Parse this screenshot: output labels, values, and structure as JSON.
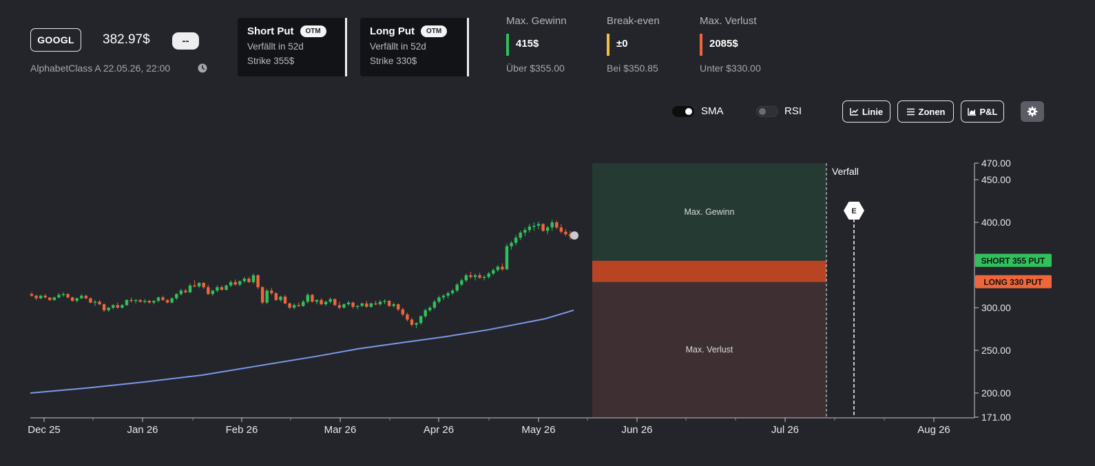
{
  "header": {
    "ticker": "GOOGL",
    "price": "382.97$",
    "change": "--",
    "subline": "AlphabetClass A 22.05.26, 22:00"
  },
  "legs": [
    {
      "title": "Short Put",
      "badge": "OTM",
      "expiry": "Verfällt in 52d",
      "strike": "Strike 355$"
    },
    {
      "title": "Long Put",
      "badge": "OTM",
      "expiry": "Verfällt in 52d",
      "strike": "Strike 330$"
    }
  ],
  "stats": [
    {
      "label": "Max. Gewinn",
      "value": "415$",
      "sub": "Über $355.00",
      "color": "#2fc25b"
    },
    {
      "label": "Break-even",
      "value": "±0",
      "sub": "Bei $350.85",
      "color": "#f0c040"
    },
    {
      "label": "Max. Verlust",
      "value": "2085$",
      "sub": "Unter $330.00",
      "color": "#f0663a"
    }
  ],
  "toggles": {
    "sma": "SMA",
    "rsi": "RSI",
    "sma_on": true,
    "rsi_on": false
  },
  "buttons": {
    "line": "Linie",
    "zones": "Zonen",
    "pnl": "P&L"
  },
  "colors": {
    "up": "#2fc25b",
    "down": "#f0663a",
    "sma": "#7e98ea",
    "profit_zone": "#263a34",
    "loss_zone": "#3e3032",
    "strike_band": "#b94423"
  },
  "chart_data": {
    "type": "candlestick",
    "x_tick_labels": [
      "Dec 25",
      "Jan 26",
      "Feb 26",
      "Mar 26",
      "Apr 26",
      "May 26",
      "Jun 26",
      "Jul 26",
      "Aug 26"
    ],
    "y_tick_labels": [
      "470.00",
      "450.00",
      "400.00",
      "300.00",
      "250.00",
      "200.00",
      "171.00"
    ],
    "ylim": [
      171,
      470
    ],
    "zones": {
      "max_gain_label": "Max.  Gewinn",
      "max_loss_label": "Max.  Verlust",
      "expiry_label": "Verfall",
      "event_label": "E"
    },
    "strike_tags": [
      {
        "label": "SHORT 355 PUT",
        "value": 355,
        "color": "#2fc25b"
      },
      {
        "label": "LONG 330 PUT",
        "value": 330,
        "color": "#f0663a"
      }
    ],
    "last_price": 382.97,
    "candles": [
      [
        316,
        318,
        313,
        314
      ],
      [
        314,
        315,
        309,
        311
      ],
      [
        311,
        315,
        310,
        314
      ],
      [
        314,
        316,
        311,
        312
      ],
      [
        312,
        312,
        308,
        309
      ],
      [
        309,
        313,
        308,
        312
      ],
      [
        312,
        317,
        311,
        315
      ],
      [
        315,
        318,
        313,
        316
      ],
      [
        316,
        317,
        311,
        312
      ],
      [
        312,
        313,
        307,
        308
      ],
      [
        308,
        312,
        306,
        311
      ],
      [
        311,
        316,
        310,
        314
      ],
      [
        314,
        315,
        310,
        311
      ],
      [
        311,
        312,
        305,
        306
      ],
      [
        306,
        309,
        302,
        307
      ],
      [
        307,
        309,
        303,
        304
      ],
      [
        304,
        305,
        295,
        297
      ],
      [
        297,
        301,
        295,
        300
      ],
      [
        300,
        304,
        298,
        303
      ],
      [
        303,
        306,
        299,
        300
      ],
      [
        300,
        304,
        299,
        303
      ],
      [
        303,
        310,
        302,
        309
      ],
      [
        309,
        312,
        306,
        308
      ],
      [
        308,
        310,
        305,
        309
      ],
      [
        309,
        310,
        306,
        307
      ],
      [
        307,
        310,
        305,
        308
      ],
      [
        308,
        309,
        305,
        306
      ],
      [
        306,
        309,
        304,
        308
      ],
      [
        308,
        313,
        306,
        312
      ],
      [
        312,
        314,
        308,
        309
      ],
      [
        309,
        310,
        305,
        306
      ],
      [
        306,
        312,
        305,
        311
      ],
      [
        311,
        317,
        309,
        316
      ],
      [
        316,
        322,
        314,
        320
      ],
      [
        320,
        322,
        317,
        318
      ],
      [
        318,
        328,
        317,
        326
      ],
      [
        326,
        332,
        324,
        325
      ],
      [
        325,
        330,
        323,
        329
      ],
      [
        329,
        330,
        322,
        324
      ],
      [
        324,
        327,
        315,
        316
      ],
      [
        316,
        321,
        314,
        320
      ],
      [
        320,
        326,
        318,
        324
      ],
      [
        324,
        326,
        320,
        321
      ],
      [
        321,
        327,
        320,
        326
      ],
      [
        326,
        332,
        324,
        330
      ],
      [
        330,
        333,
        326,
        327
      ],
      [
        327,
        332,
        325,
        331
      ],
      [
        331,
        336,
        329,
        334
      ],
      [
        334,
        336,
        329,
        330
      ],
      [
        330,
        340,
        328,
        338
      ],
      [
        338,
        339,
        322,
        324
      ],
      [
        324,
        325,
        304,
        306
      ],
      [
        306,
        322,
        304,
        320
      ],
      [
        320,
        323,
        315,
        317
      ],
      [
        317,
        318,
        308,
        309
      ],
      [
        309,
        314,
        307,
        313
      ],
      [
        313,
        315,
        304,
        305
      ],
      [
        305,
        306,
        298,
        300
      ],
      [
        300,
        305,
        298,
        303
      ],
      [
        303,
        306,
        301,
        302
      ],
      [
        302,
        309,
        301,
        307
      ],
      [
        307,
        317,
        305,
        315
      ],
      [
        315,
        316,
        306,
        307
      ],
      [
        307,
        310,
        304,
        309
      ],
      [
        309,
        311,
        303,
        304
      ],
      [
        304,
        308,
        302,
        307
      ],
      [
        307,
        312,
        305,
        310
      ],
      [
        310,
        311,
        302,
        303
      ],
      [
        303,
        307,
        298,
        300
      ],
      [
        300,
        305,
        299,
        304
      ],
      [
        304,
        308,
        302,
        306
      ],
      [
        306,
        307,
        299,
        301
      ],
      [
        301,
        303,
        298,
        302
      ],
      [
        302,
        306,
        301,
        305
      ],
      [
        305,
        308,
        300,
        301
      ],
      [
        301,
        306,
        300,
        305
      ],
      [
        305,
        308,
        303,
        304
      ],
      [
        304,
        309,
        302,
        307
      ],
      [
        307,
        310,
        304,
        308
      ],
      [
        308,
        309,
        301,
        302
      ],
      [
        302,
        306,
        300,
        304
      ],
      [
        304,
        305,
        296,
        298
      ],
      [
        298,
        300,
        290,
        292
      ],
      [
        292,
        294,
        284,
        286
      ],
      [
        286,
        288,
        278,
        280
      ],
      [
        280,
        283,
        276,
        282
      ],
      [
        282,
        291,
        280,
        290
      ],
      [
        290,
        299,
        288,
        297
      ],
      [
        297,
        302,
        295,
        300
      ],
      [
        300,
        309,
        298,
        307
      ],
      [
        307,
        314,
        305,
        312
      ],
      [
        312,
        316,
        309,
        314
      ],
      [
        314,
        319,
        311,
        317
      ],
      [
        317,
        322,
        315,
        320
      ],
      [
        320,
        329,
        318,
        327
      ],
      [
        327,
        334,
        325,
        332
      ],
      [
        332,
        340,
        330,
        338
      ],
      [
        338,
        342,
        334,
        336
      ],
      [
        336,
        340,
        332,
        338
      ],
      [
        338,
        341,
        334,
        335
      ],
      [
        335,
        338,
        332,
        336
      ],
      [
        336,
        342,
        334,
        340
      ],
      [
        340,
        346,
        338,
        344
      ],
      [
        344,
        350,
        342,
        348
      ],
      [
        348,
        352,
        343,
        345
      ],
      [
        345,
        375,
        344,
        372
      ],
      [
        372,
        378,
        368,
        376
      ],
      [
        376,
        385,
        373,
        382
      ],
      [
        382,
        390,
        379,
        388
      ],
      [
        388,
        394,
        384,
        391
      ],
      [
        391,
        398,
        388,
        395
      ],
      [
        395,
        400,
        390,
        396
      ],
      [
        396,
        401,
        392,
        398
      ],
      [
        398,
        399,
        389,
        390
      ],
      [
        390,
        396,
        386,
        394
      ],
      [
        394,
        403,
        390,
        400
      ],
      [
        400,
        402,
        392,
        394
      ],
      [
        394,
        398,
        387,
        389
      ],
      [
        389,
        392,
        384,
        386
      ],
      [
        386,
        390,
        380,
        384
      ]
    ],
    "sma_points": [
      [
        0,
        200.0
      ],
      [
        20,
        206
      ],
      [
        40,
        213
      ],
      [
        60,
        221
      ],
      [
        80,
        232
      ],
      [
        100,
        243
      ],
      [
        115,
        252
      ],
      [
        130,
        259
      ],
      [
        145,
        266
      ],
      [
        160,
        274
      ],
      [
        180,
        287
      ],
      [
        190,
        297
      ]
    ]
  }
}
